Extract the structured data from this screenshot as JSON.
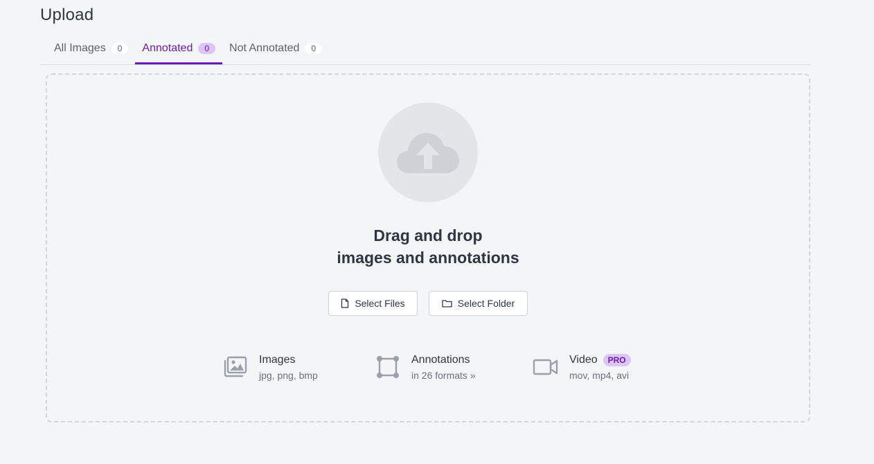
{
  "page": {
    "title": "Upload"
  },
  "tabs": [
    {
      "label": "All Images",
      "count": "0"
    },
    {
      "label": "Annotated",
      "count": "0"
    },
    {
      "label": "Not Annotated",
      "count": "0"
    }
  ],
  "dropzone": {
    "headline_line1": "Drag and drop",
    "headline_line2": "images and annotations",
    "select_files_label": "Select Files",
    "select_folder_label": "Select Folder"
  },
  "info": {
    "images": {
      "title": "Images",
      "sub": "jpg, png, bmp"
    },
    "annotations": {
      "title": "Annotations",
      "sub": "in 26 formats"
    },
    "video": {
      "title": "Video",
      "badge": "PRO",
      "sub": "mov, mp4, avi"
    }
  },
  "icons": {
    "cloud": "cloud-upload-icon",
    "file": "file-icon",
    "folder": "folder-icon",
    "images": "images-icon",
    "annotations": "bounding-box-icon",
    "video": "video-camera-icon",
    "chevron": "chevron-double-right-icon"
  },
  "colors": {
    "accent": "#6a1bb5",
    "accent_bg": "#dcc6f7",
    "background": "#f4f5f7",
    "icon_gray": "#9aa0ab"
  }
}
